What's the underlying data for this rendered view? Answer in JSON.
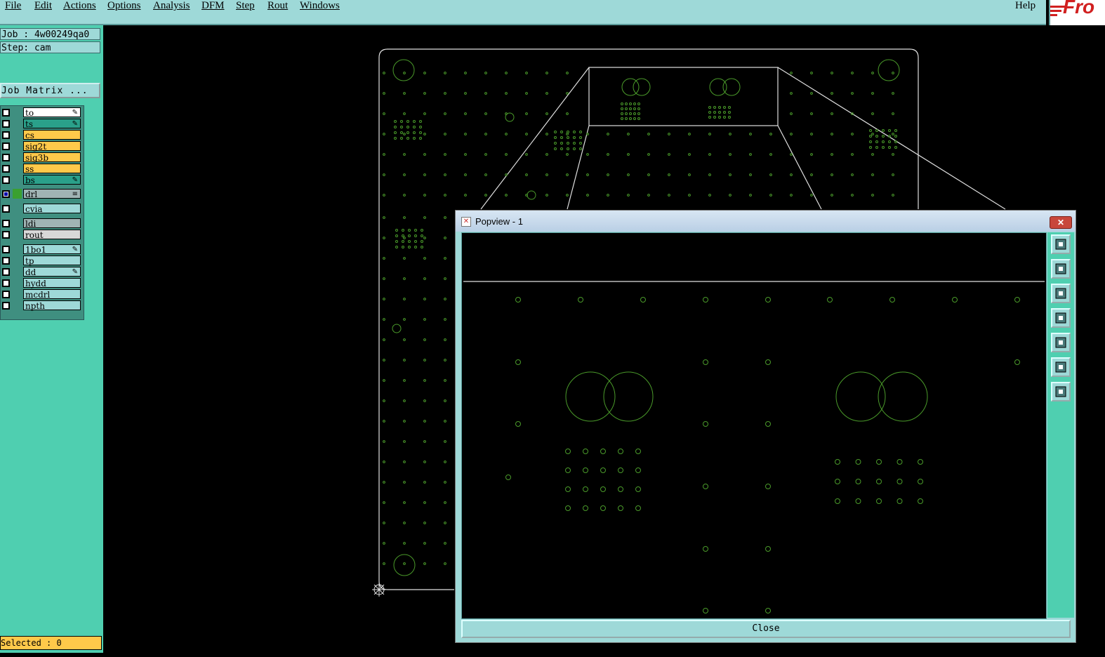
{
  "menubar": {
    "items": [
      {
        "label": "File"
      },
      {
        "label": "Edit"
      },
      {
        "label": "Actions"
      },
      {
        "label": "Options"
      },
      {
        "label": "Analysis"
      },
      {
        "label": "DFM"
      },
      {
        "label": "Step"
      },
      {
        "label": "Rout"
      },
      {
        "label": "Windows"
      }
    ],
    "help": "Help",
    "logo_text": "Fro"
  },
  "panel": {
    "job": "Job : 4w00249qa0",
    "step": "Step: cam",
    "job_matrix": "Job Matrix ...",
    "selected": "Selected : 0"
  },
  "layers": [
    {
      "name": "to",
      "color": "#ffffff",
      "mark": "✎"
    },
    {
      "name": "ts",
      "color": "#2aa08a",
      "mark": "✎"
    },
    {
      "name": "cs",
      "color": "#ffc94a",
      "mark": ""
    },
    {
      "name": "sig2t",
      "color": "#ffc94a",
      "mark": ""
    },
    {
      "name": "sig3b",
      "color": "#ffc94a",
      "mark": ""
    },
    {
      "name": "ss",
      "color": "#ffc94a",
      "mark": ""
    },
    {
      "name": "bs",
      "color": "#2aa08a",
      "mark": "✎"
    },
    {
      "name": "drl",
      "color": "#a0b4b4",
      "mark": "≡",
      "active": true
    },
    {
      "name": "cvia",
      "color": "#9ed9d8",
      "mark": ""
    },
    {
      "name": "ldi",
      "color": "#a0b4b4",
      "mark": ""
    },
    {
      "name": "rout",
      "color": "#d8d8d8",
      "mark": ""
    },
    {
      "name": "1bo1",
      "color": "#9ed9d8",
      "mark": "✎"
    },
    {
      "name": "tp",
      "color": "#9ed9d8",
      "mark": ""
    },
    {
      "name": "dd",
      "color": "#9ed9d8",
      "mark": "✎"
    },
    {
      "name": "hydd",
      "color": "#9ed9d8",
      "mark": ""
    },
    {
      "name": "mcdrl",
      "color": "#9ed9d8",
      "mark": ""
    },
    {
      "name": "npth",
      "color": "#9ed9d8",
      "mark": ""
    }
  ],
  "popview": {
    "title": "Popview - 1",
    "close_label": "Close",
    "tools": [
      "zoom-window-icon",
      "pan-up-icon",
      "pan-down-icon",
      "pan-left-icon",
      "pan-right-icon",
      "zoom-fit-icon",
      "center-icon"
    ]
  },
  "colors": {
    "drill_green": "#4a9a2a",
    "outline": "#e0e0e0",
    "panel": "#4fcfb0",
    "menubar": "#9ed9d8"
  }
}
